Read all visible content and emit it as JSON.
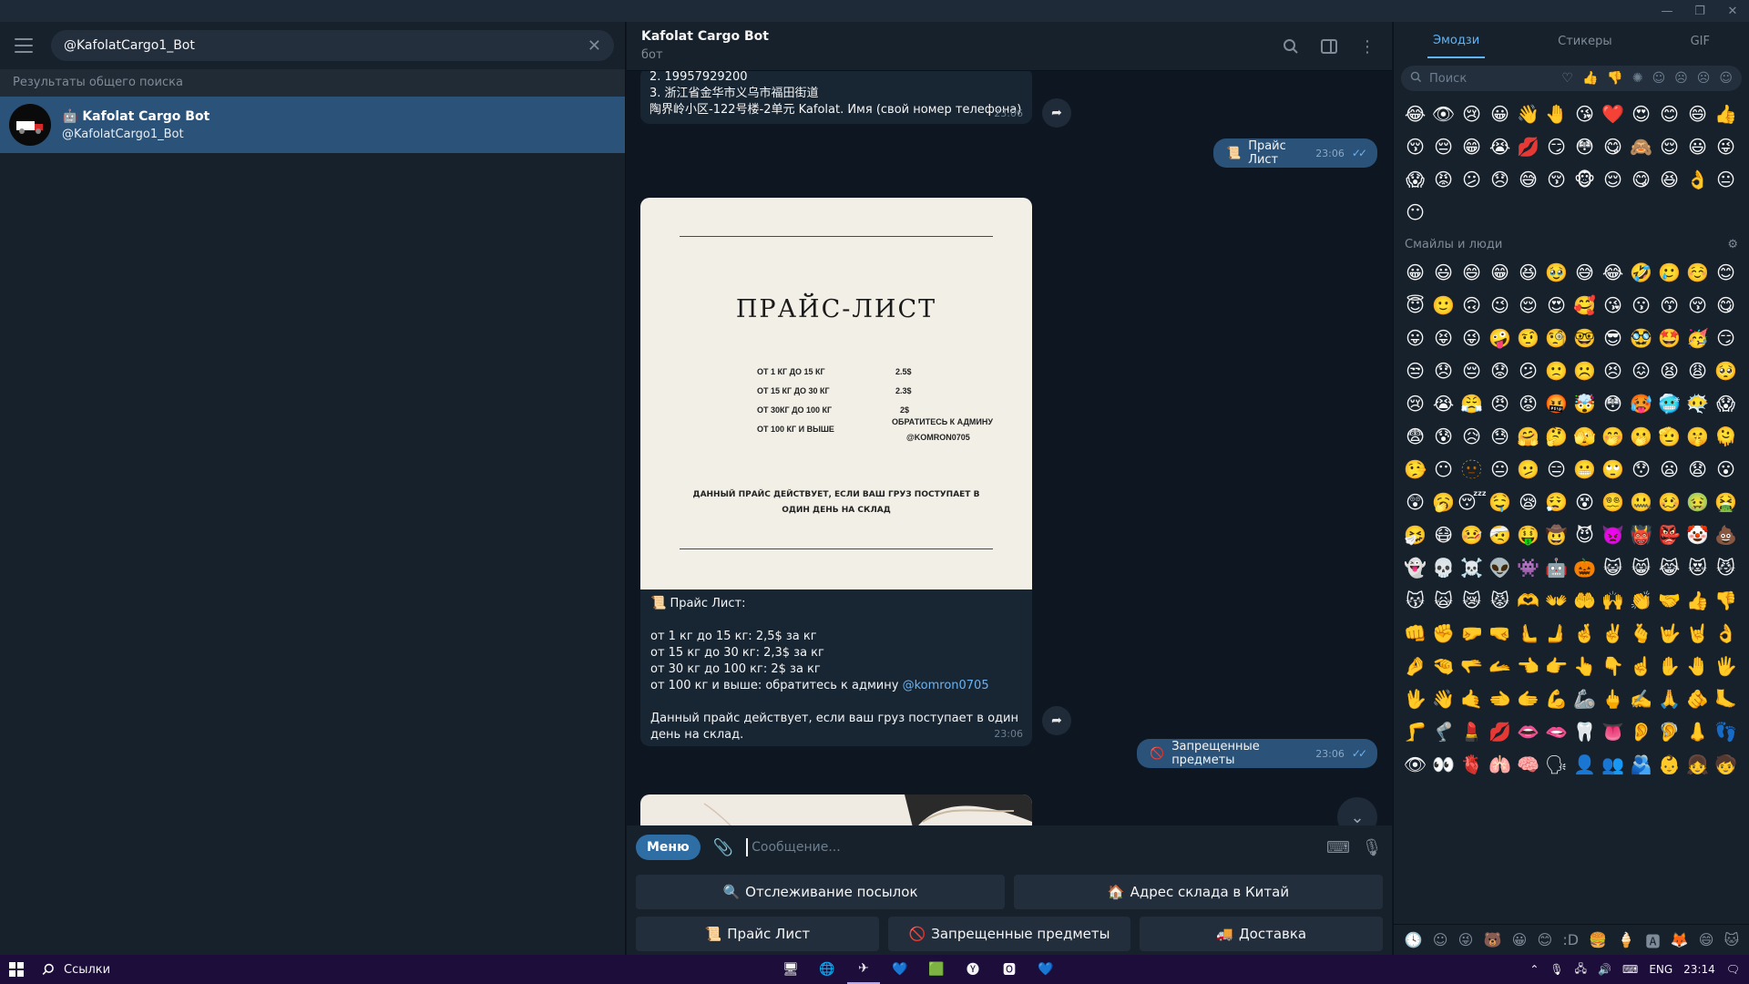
{
  "window": {
    "minimize": "—",
    "restore": "❐",
    "close": "✕"
  },
  "left": {
    "search_value": "@KafolatCargo1_Bot",
    "section_label": "Результаты общего поиска",
    "result": {
      "name": "Kafolat Cargo Bot",
      "username": "@KafolatCargo1_Bot",
      "bot_glyph": "🤖"
    }
  },
  "chat": {
    "title": "Kafolat Cargo Bot",
    "status": "бот",
    "messages": {
      "addr_line1": "2. 19957929200",
      "addr_line2": "3. 浙江省金华市义乌市福田街道",
      "addr_line3": "陶界岭小区-122号楼-2单元 Kafolat. Имя (свой номер телефона)",
      "addr_time": "23:06",
      "out1_emoji": "📜",
      "out1_text": "Прайс Лист",
      "out1_time": "23:06",
      "card": {
        "title": "ПРАЙС-ЛИСТ",
        "rows": [
          {
            "label": "ОТ 1 КГ ДО 15 КГ",
            "value": "2.5$"
          },
          {
            "label": "ОТ 15 КГ ДО 30 КГ",
            "value": "2.3$"
          },
          {
            "label": "ОТ 30КГ ДО 100 КГ",
            "value": "2$"
          },
          {
            "label": "ОТ 100 КГ И ВЫШЕ",
            "value": "ОБРАТИТЕСЬ К АДМИНУ"
          }
        ],
        "admin": "@KOMRON0705",
        "note1": "ДАННЫЙ ПРАЙС ДЕЙСТВУЕТ, ЕСЛИ ВАШ ГРУЗ ПОСТУПАЕТ В",
        "note2": "ОДИН ДЕНЬ НА СКЛАД"
      },
      "caption_emoji": "📜",
      "caption_title": "Прайс Лист:",
      "caption_l1": "от 1 кг до 15 кг: 2,5$ за кг",
      "caption_l2": "от 15 кг до 30 кг: 2,3$ за кг",
      "caption_l3": "от 30 кг до 100 кг: 2$ за кг",
      "caption_l4": "от 100 кг и выше: обратитесь к админу ",
      "caption_link": "@komron0705",
      "caption_note": "Данный прайс действует, если ваш груз поступает в один день на склад.",
      "caption_time": "23:06",
      "out2_emoji": "🚫",
      "out2_text": "Запрещенные предметы",
      "out2_time": "23:06"
    },
    "composer": {
      "menu_label": "Меню",
      "placeholder": "Сообщение..."
    },
    "keyboard": [
      [
        {
          "emoji": "🔍",
          "label": "Отслеживание посылок"
        },
        {
          "emoji": "🏠",
          "label": "Адрес склада в Китай"
        }
      ],
      [
        {
          "emoji": "📜",
          "label": "Прайс Лист"
        },
        {
          "emoji": "🚫",
          "label": "Запрещенные предметы"
        },
        {
          "emoji": "🚚",
          "label": "Доставка"
        }
      ]
    ]
  },
  "emoji_panel": {
    "tabs": [
      "Эмодзи",
      "Стикеры",
      "GIF"
    ],
    "search_placeholder": "Поиск",
    "category_label": "Смайлы и люди",
    "recent": [
      "😂",
      "👁",
      "😢",
      "😀",
      "👋",
      "🤚",
      "😘",
      "❤️",
      "😍",
      "😊",
      "😄",
      "👍",
      "😚",
      "😔",
      "😁",
      "😭",
      "💋",
      "😏",
      "😳",
      "😋",
      "🙈",
      "😌",
      "😃",
      "😜",
      "😱",
      "😡",
      "😕",
      "😞",
      "😅",
      "😚",
      "🐵",
      "😌",
      "😋",
      "😆",
      "👌",
      "😐",
      "😶"
    ],
    "people": [
      "😀",
      "😃",
      "😄",
      "😁",
      "😆",
      "🥹",
      "😅",
      "😂",
      "🤣",
      "🥲",
      "☺️",
      "😊",
      "😇",
      "🙂",
      "🙃",
      "😉",
      "😌",
      "😍",
      "🥰",
      "😘",
      "😗",
      "😙",
      "😚",
      "😋",
      "😛",
      "😝",
      "😜",
      "🤪",
      "🤨",
      "🧐",
      "🤓",
      "😎",
      "🥸",
      "🤩",
      "🥳",
      "😏",
      "😒",
      "😞",
      "😔",
      "😟",
      "😕",
      "🙁",
      "☹️",
      "😣",
      "😖",
      "😫",
      "😩",
      "🥺",
      "😢",
      "😭",
      "😤",
      "😠",
      "😡",
      "🤬",
      "🤯",
      "😳",
      "🥵",
      "🥶",
      "😶‍🌫️",
      "😱",
      "😨",
      "😰",
      "😥",
      "😓",
      "🤗",
      "🤔",
      "🫣",
      "🤭",
      "🫢",
      "🫡",
      "🤫",
      "🫠",
      "🤥",
      "😶",
      "🫥",
      "😐",
      "🫤",
      "😑",
      "😬",
      "🙄",
      "😯",
      "😦",
      "😧",
      "😮",
      "😲",
      "🥱",
      "😴",
      "🤤",
      "😪",
      "😮‍💨",
      "😵",
      "😵‍💫",
      "🤐",
      "🥴",
      "🤢",
      "🤮",
      "🤧",
      "😷",
      "🤒",
      "🤕",
      "🤑",
      "🤠",
      "😈",
      "👿",
      "👹",
      "👺",
      "🤡",
      "💩",
      "👻",
      "💀",
      "☠️",
      "👽",
      "👾",
      "🤖",
      "🎃",
      "😺",
      "😸",
      "😹",
      "😻",
      "😼",
      "😽",
      "🙀",
      "😿",
      "😾",
      "🫶",
      "👐",
      "🤲",
      "🙌",
      "👏",
      "🤝",
      "👍",
      "👎",
      "👊",
      "✊",
      "🤛",
      "🤜",
      "🫷",
      "🫸",
      "🤞",
      "✌️",
      "🫰",
      "🤟",
      "🤘",
      "👌",
      "🤌",
      "🤏",
      "🫳",
      "🫴",
      "👈",
      "👉",
      "👆",
      "👇",
      "☝️",
      "✋",
      "🤚",
      "🖐",
      "🖖",
      "👋",
      "🤙",
      "🫲",
      "🫱",
      "💪",
      "🦾",
      "🖕",
      "✍️",
      "🙏",
      "🫵",
      "🦶",
      "🦵",
      "🦿",
      "💄",
      "💋",
      "👄",
      "🫦",
      "🦷",
      "👅",
      "👂",
      "🦻",
      "👃",
      "👣",
      "👁",
      "👀",
      "🫀",
      "🫁",
      "🧠",
      "🗣",
      "👤",
      "👥",
      "🫂",
      "👶",
      "👧",
      "🧒",
      "👦",
      "👩",
      "🧑",
      "👨"
    ],
    "footer": [
      "🕓",
      "☺",
      "😜",
      "🐻",
      "😀",
      "😊",
      ":D",
      "🍔",
      "🍦",
      "🅰",
      "🦊",
      "😄",
      "🐱"
    ]
  },
  "taskbar": {
    "search_label": "Ссылки",
    "apps": [
      "🖥",
      "🌐",
      "✈",
      "💙",
      "🟩",
      "🅨",
      "🅾",
      "💙"
    ],
    "lang": "ENG",
    "clock": "23:14"
  }
}
